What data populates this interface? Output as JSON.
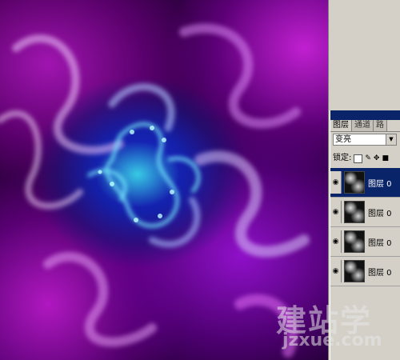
{
  "layers_panel": {
    "tabs": [
      {
        "label": "图层",
        "active": true
      },
      {
        "label": "通道",
        "active": false
      },
      {
        "label": "路",
        "active": false
      }
    ],
    "blend_mode": "变亮",
    "lock_label": "锁定:",
    "layers": [
      {
        "name": "图层 0",
        "selected": true
      },
      {
        "name": "图层 0",
        "selected": false
      },
      {
        "name": "图层 0",
        "selected": false
      },
      {
        "name": "图层 0",
        "selected": false
      }
    ]
  },
  "watermark": {
    "logo_text": "建站学",
    "url_text": "jzxue.com"
  },
  "colors": {
    "panel_bg": "#d4d0c8",
    "selection": "#0a246a",
    "artwork_purple": "#a015b0",
    "artwork_blue": "#1a2bd0",
    "artwork_cyan": "#3ce6e6"
  }
}
